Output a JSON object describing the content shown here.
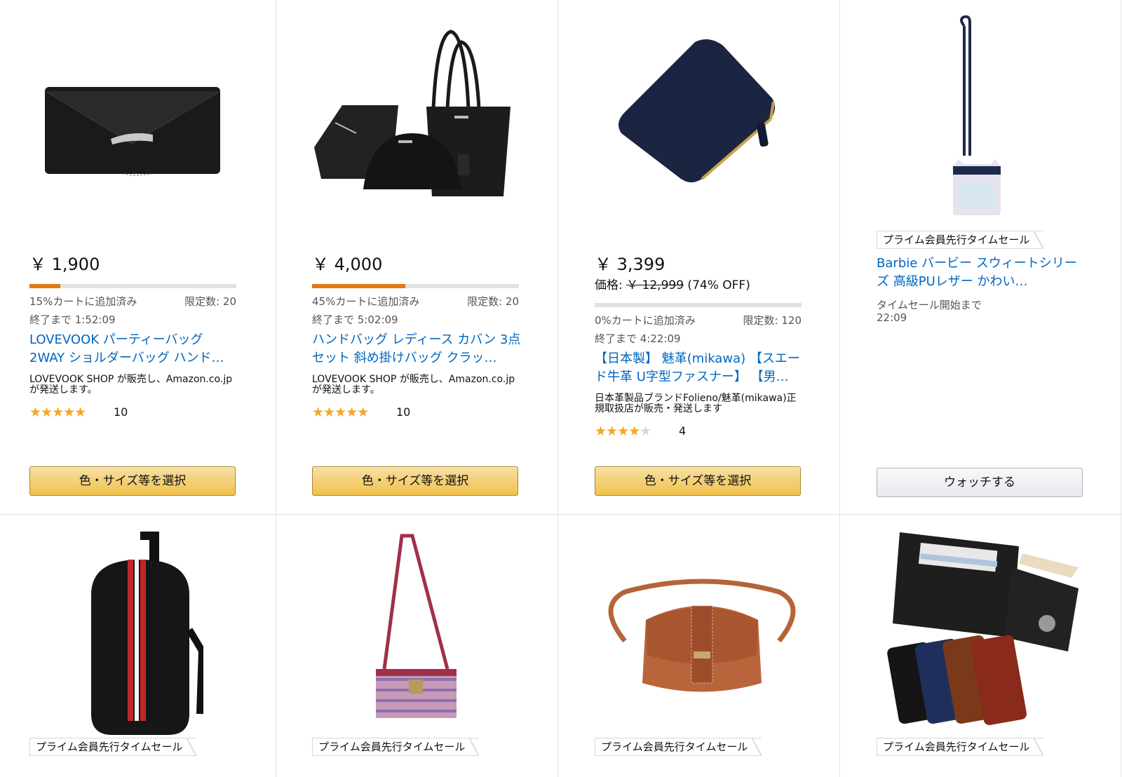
{
  "products": [
    {
      "price": "￥ 1,900",
      "claimed": "15%カートに追加済み",
      "claimed_pct": 15,
      "limit": "限定数: 20",
      "ends": "終了まで 1:52:09",
      "title": "LOVEVOOK パーティーバッグ 2WAY ショルダーバッグ ハンド…",
      "seller": "LOVEVOOK SHOP が販売し、Amazon.co.jpが発送します。",
      "rating_stars": "★★★★★",
      "rating": 5,
      "review_count": "10",
      "button": "色・サイズ等を選択"
    },
    {
      "price": "￥ 4,000",
      "claimed": "45%カートに追加済み",
      "claimed_pct": 45,
      "limit": "限定数: 20",
      "ends": "終了まで 5:02:09",
      "title": "ハンドバッグ レディース カバン 3点セット 斜め掛けバッグ クラッ…",
      "seller": "LOVEVOOK SHOP が販売し、Amazon.co.jpが発送します。",
      "rating_stars": "★★★★★",
      "rating": 5,
      "review_count": "10",
      "button": "色・サイズ等を選択"
    },
    {
      "price": "￥ 3,399",
      "list_price_label": "価格: ",
      "list_price": "￥ 12,999",
      "discount": " (74% OFF)",
      "claimed": "0%カートに追加済み",
      "claimed_pct": 0,
      "limit": "限定数: 120",
      "ends": "終了まで 4:22:09",
      "title": "【日本製】 魅革(mikawa) 【スエード牛革 U字型ファスナー】 【男…",
      "seller": "日本革製品ブランドFolieno/魅革(mikawa)正規取扱店が販売・発送します",
      "rating_stars": "★★★★",
      "rating_half": "★",
      "rating": 4.5,
      "review_count": "4",
      "button": "色・サイズ等を選択"
    },
    {
      "badge": "プライム会員先行タイムセール",
      "title": "Barbie バービー スウィートシリーズ 高級PUレザー かわい…",
      "countdown_label": "タイムセール開始まで",
      "countdown": "22:09",
      "button": "ウォッチする"
    }
  ],
  "row2_badges": [
    "プライム会員先行タイムセール",
    "プライム会員先行タイムセール",
    "プライム会員先行タイムセール",
    "プライム会員先行タイムセール"
  ],
  "colors": {
    "link": "#0066c0",
    "progress": "#e47911",
    "star": "#f5a623",
    "button_primary": "#f0c14b"
  }
}
